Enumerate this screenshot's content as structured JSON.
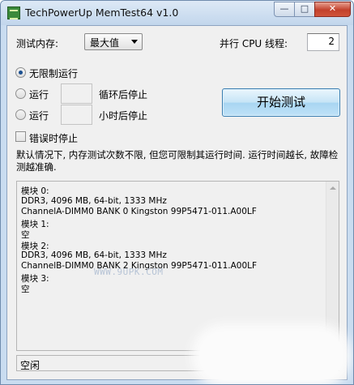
{
  "window": {
    "title": "TechPowerUp MemTest64 v1.0",
    "controls": {
      "minimize": "—",
      "maximize": "□",
      "close": "✕"
    }
  },
  "memory_label": "测试内存:",
  "memory_select": {
    "value": "最大值"
  },
  "threads_label": "并行 CPU 线程:",
  "threads_value": "2",
  "modes": {
    "unlimited": "无限制运行",
    "cycles_prefix": "运行",
    "cycles_suffix": "循环后停止",
    "hours_prefix": "运行",
    "hours_suffix": "小时后停止",
    "stop_on_error": "错误时停止"
  },
  "start_button": "开始测试",
  "info_text": "默认情况下, 内存测试次数不限, 但您可限制其运行时间. 运行时间越长, 故障检测越准确.",
  "log": {
    "lines": [
      "模块 0:",
      "  DDR3, 4096 MB, 64-bit, 1333 MHz",
      "  ChannelA-DIMM0 BANK 0 Kingston 99P5471-011.A00LF",
      "模块 1:",
      "  空",
      "模块 2:",
      "  DDR3, 4096 MB, 64-bit, 1333 MHz",
      "  ChannelB-DIMM0 BANK 2 Kingston 99P5471-011.A00LF",
      "模块 3:",
      "  空"
    ],
    "watermark": "WWW.9UPK.COM"
  },
  "status": "空闲"
}
